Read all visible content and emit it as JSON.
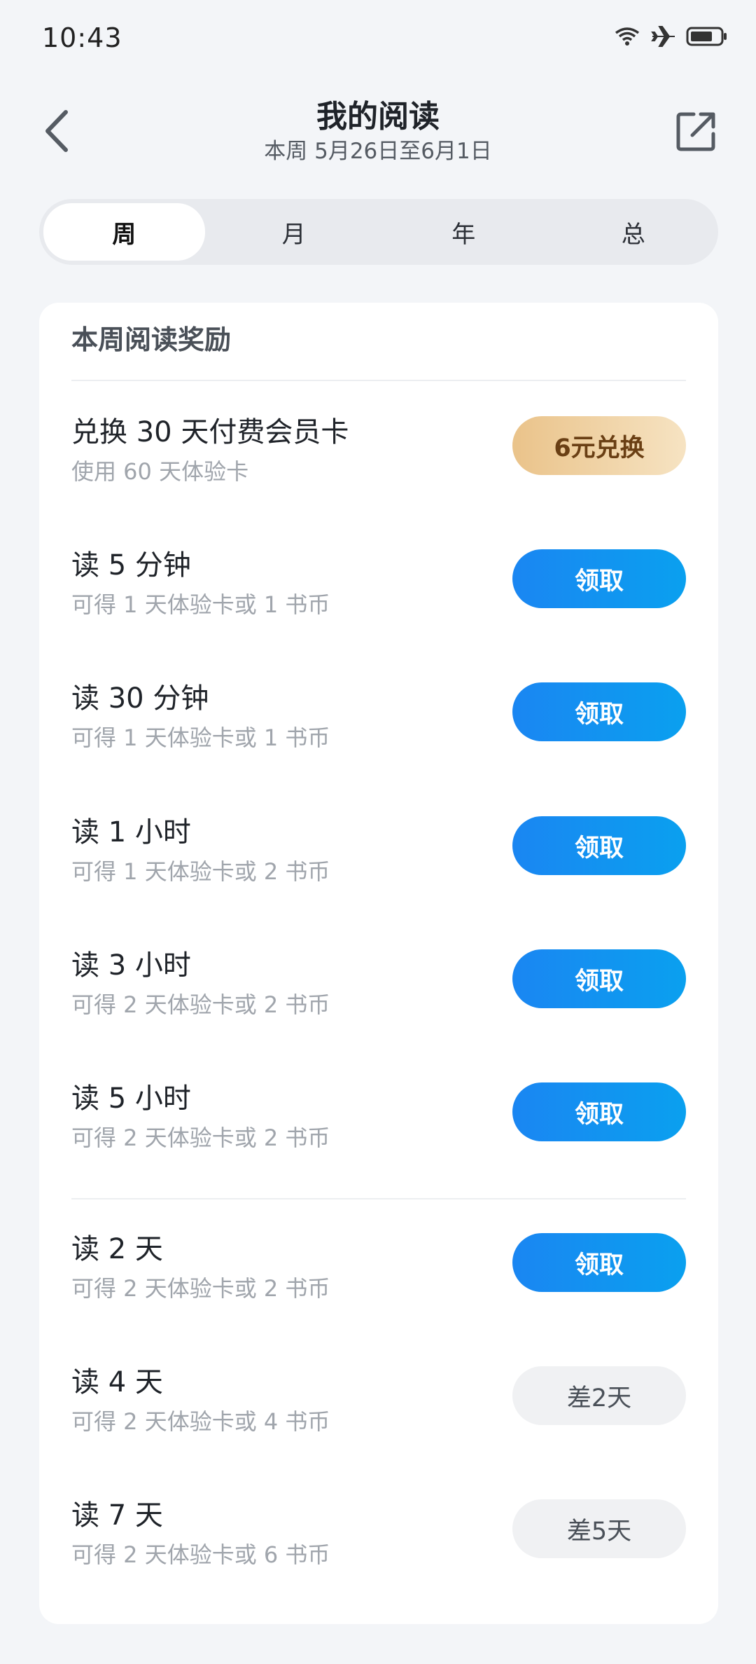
{
  "status_bar": {
    "time": "10:43"
  },
  "header": {
    "title": "我的阅读",
    "subtitle": "本周 5月26日至6月1日"
  },
  "tabs": [
    {
      "label": "周",
      "active": true
    },
    {
      "label": "月",
      "active": false
    },
    {
      "label": "年",
      "active": false
    },
    {
      "label": "总",
      "active": false
    }
  ],
  "rewards": {
    "section_title": "本周阅读奖励",
    "exchange": {
      "title": "兑换 30 天付费会员卡",
      "subtitle": "使用 60 天体验卡",
      "button": "6元兑换"
    },
    "time_items": [
      {
        "title": "读 5 分钟",
        "subtitle": "可得 1 天体验卡或 1 书币",
        "button": "领取"
      },
      {
        "title": "读 30 分钟",
        "subtitle": "可得 1 天体验卡或 1 书币",
        "button": "领取"
      },
      {
        "title": "读 1 小时",
        "subtitle": "可得 1 天体验卡或 2 书币",
        "button": "领取"
      },
      {
        "title": "读 3 小时",
        "subtitle": "可得 2 天体验卡或 2 书币",
        "button": "领取"
      },
      {
        "title": "读 5 小时",
        "subtitle": "可得 2 天体验卡或 2 书币",
        "button": "领取"
      }
    ],
    "day_items": [
      {
        "title": "读 2 天",
        "subtitle": "可得 2 天体验卡或 2 书币",
        "button": "领取"
      },
      {
        "title": "读 4 天",
        "subtitle": "可得 2 天体验卡或 4 书币",
        "button": "差2天"
      },
      {
        "title": "读 7 天",
        "subtitle": "可得 2 天体验卡或 6 书币",
        "button": "差5天"
      }
    ]
  },
  "colors": {
    "accent_blue": "#1a86f2",
    "gold": "#eac38a",
    "background": "#f3f5f8"
  }
}
